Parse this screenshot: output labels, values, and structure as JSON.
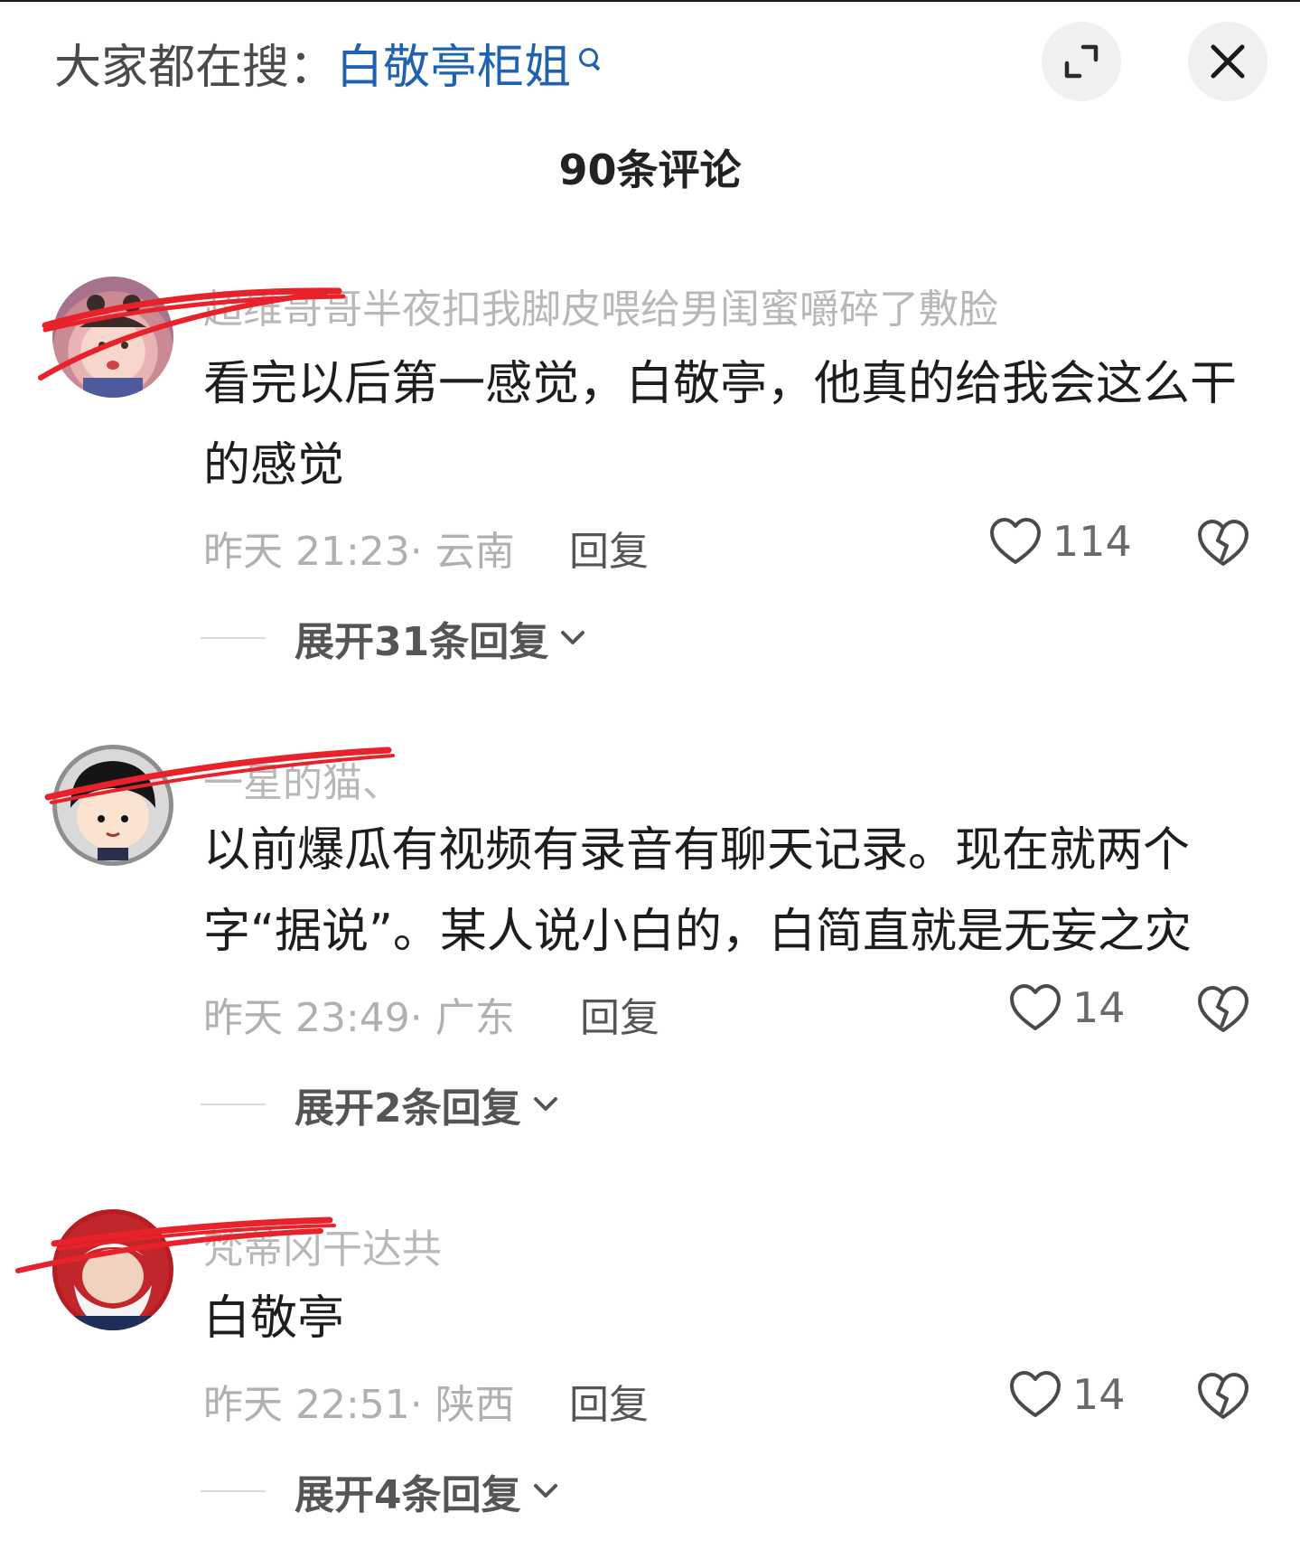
{
  "search": {
    "prefix": "大家都在搜：",
    "term": "白敬亭柜姐",
    "search_icon": "search-icon"
  },
  "header": {
    "expand_icon": "expand-icon",
    "close_icon": "close-icon",
    "title": "90条评论"
  },
  "comments": [
    {
      "username": "超维哥哥半夜扣我脚皮喂给男闺蜜嚼碎了敷脸",
      "text": "看完以后第一感觉，白敬亭，他真的给我会这么干的感觉",
      "time": "昨天 21:23",
      "location": "云南",
      "reply": "回复",
      "likes": "114",
      "expand": "展开31条回复"
    },
    {
      "username": "一星的猫、",
      "text": "以前爆瓜有视频有录音有聊天记录。现在就两个字“据说”。某人说小白的，白简直就是无妄之灾",
      "time": "昨天 23:49",
      "location": "广东",
      "reply": "回复",
      "likes": "14",
      "expand": "展开2条回复"
    },
    {
      "username": "梵蒂冈干达共",
      "text": "白敬亭",
      "time": "昨天 22:51",
      "location": "陕西",
      "reply": "回复",
      "likes": "14",
      "expand": "展开4条回复"
    }
  ]
}
